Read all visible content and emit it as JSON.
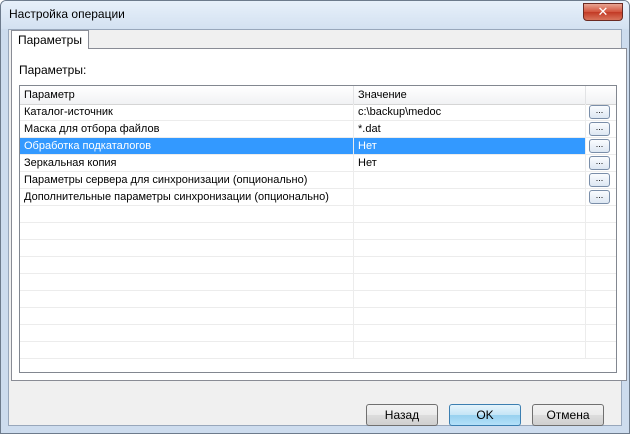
{
  "window": {
    "title": "Настройка операции",
    "close_label": "✕"
  },
  "tabs": [
    {
      "label": "Параметры"
    }
  ],
  "panel": {
    "section_label": "Параметры:"
  },
  "grid": {
    "columns": [
      {
        "label": "Параметр"
      },
      {
        "label": "Значение"
      },
      {
        "label": ""
      }
    ],
    "rows": [
      {
        "param": "Каталог-источник",
        "value": "c:\\backup\\medoc",
        "button": "...",
        "selected": false
      },
      {
        "param": "Маска для отбора файлов",
        "value": "*.dat",
        "button": "...",
        "selected": false
      },
      {
        "param": "Обработка подкаталогов",
        "value": "Нет",
        "button": "...",
        "selected": true
      },
      {
        "param": "Зеркальная копия",
        "value": "Нет",
        "button": "...",
        "selected": false
      },
      {
        "param": "Параметры сервера для синхронизации (опционально)",
        "value": "",
        "button": "...",
        "selected": false
      },
      {
        "param": "Дополнительные параметры синхронизации (опционально)",
        "value": "",
        "button": "...",
        "selected": false
      }
    ],
    "empty_rows": 9
  },
  "buttons": {
    "back": "Назад",
    "ok": "OK",
    "cancel": "Отмена"
  }
}
